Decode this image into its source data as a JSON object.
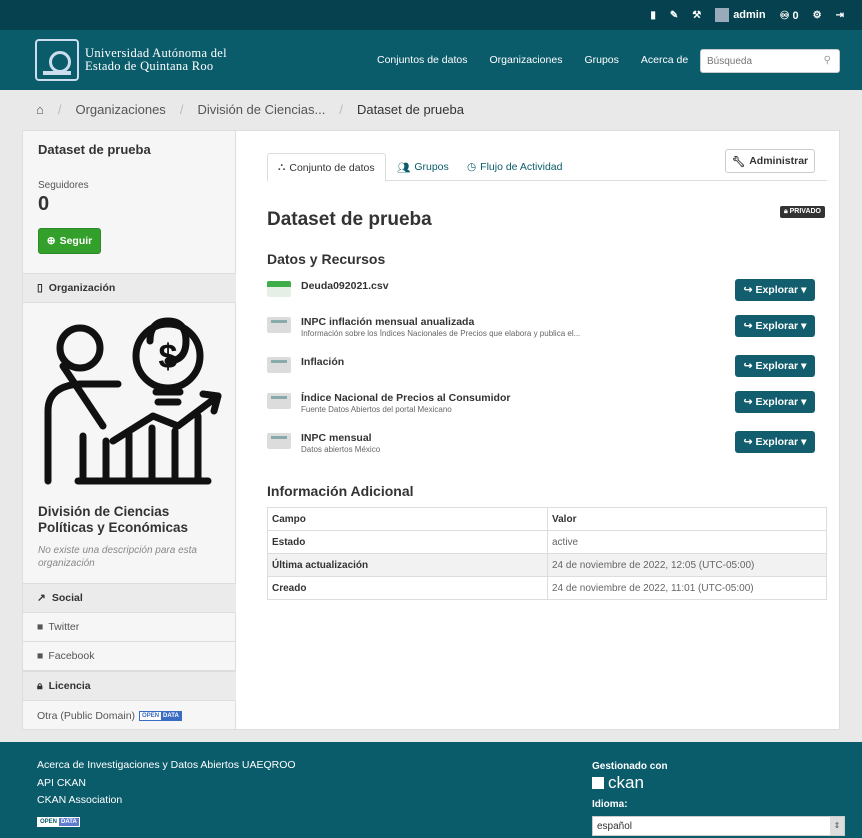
{
  "account": {
    "user": "admin",
    "counter": "0"
  },
  "masthead": {
    "logo_line1": "Universidad Autónoma del",
    "logo_line2": "Estado de Quintana Roo",
    "nav": [
      "Conjuntos de datos",
      "Organizaciones",
      "Grupos",
      "Acerca de"
    ],
    "search_placeholder": "Búsqueda"
  },
  "breadcrumb": [
    "Organizaciones",
    "División de Ciencias...",
    "Dataset de prueba"
  ],
  "sidebar": {
    "title": "Dataset de prueba",
    "followers_label": "Seguidores",
    "followers_count": "0",
    "follow_label": "Seguir",
    "organization_heading": "Organización",
    "org_name": "División de Ciencias Políticas y Económicas",
    "org_description": "No existe una descripción para esta organización",
    "social_heading": "Social",
    "twitter": "Twitter",
    "facebook": "Facebook",
    "license_heading": "Licencia",
    "license_text": "Otra (Public Domain)",
    "od_badge_a": "OPEN",
    "od_badge_b": "DATA"
  },
  "tabs": [
    "Conjunto de datos",
    "Grupos",
    "Flujo de Actividad"
  ],
  "admin_label": "Administrar",
  "dataset_title": "Dataset de prueba",
  "private_label": "PRIVADO",
  "resources_heading": "Datos y Recursos",
  "explore_label": "Explorar",
  "resources": [
    {
      "name": "Deuda092021.csv",
      "desc": ""
    },
    {
      "name": "INPC inflación mensual anualizada",
      "desc": "Información sobre los Índices Nacionales de Precios que elabora y publica el..."
    },
    {
      "name": "Inflación",
      "desc": ""
    },
    {
      "name": "Índice Nacional de Precios al Consumidor",
      "desc": "Fuente Datos Abiertos del portal Mexicano"
    },
    {
      "name": "INPC mensual",
      "desc": "Datos abiertos México"
    }
  ],
  "additional_heading": "Información Adicional",
  "info_table": {
    "headers": [
      "Campo",
      "Valor"
    ],
    "rows": [
      [
        "Estado",
        "active"
      ],
      [
        "Última actualización",
        "24 de noviembre de 2022, 12:05 (UTC-05:00)"
      ],
      [
        "Creado",
        "24 de noviembre de 2022, 11:01 (UTC-05:00)"
      ]
    ]
  },
  "footer": {
    "links": [
      "Acerca de Investigaciones y Datos Abiertos UAEQROO",
      "API CKAN",
      "CKAN Association"
    ],
    "powered_by": "Gestionado con",
    "ckan": "ckan",
    "language_label": "Idioma:",
    "language_value": "español",
    "od_a": "OPEN",
    "od_b": "DATA"
  }
}
